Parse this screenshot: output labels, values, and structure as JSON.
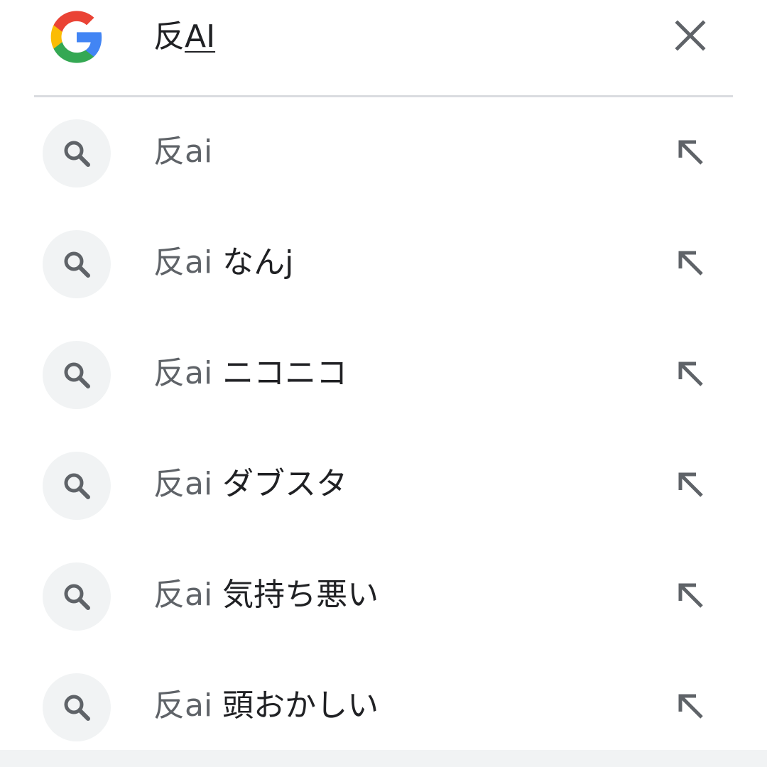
{
  "search": {
    "query_prefix": "反",
    "query_typed": "AI"
  },
  "colors": {
    "text_primary": "#202124",
    "text_secondary": "#5f6368",
    "icon_bg": "#f1f3f4",
    "divider": "#dadce0"
  },
  "icons": {
    "logo": "google-g-icon",
    "clear": "close-icon",
    "suggestion": "search-icon",
    "fill_query": "arrow-up-left-icon"
  },
  "suggestions": [
    {
      "prefix": "反ai",
      "suffix": ""
    },
    {
      "prefix": "反ai",
      "suffix": " なんj"
    },
    {
      "prefix": "反ai",
      "suffix": " ニコニコ"
    },
    {
      "prefix": "反ai",
      "suffix": " ダブスタ"
    },
    {
      "prefix": "反ai",
      "suffix": " 気持ち悪い"
    },
    {
      "prefix": "反ai",
      "suffix": " 頭おかしい"
    }
  ]
}
